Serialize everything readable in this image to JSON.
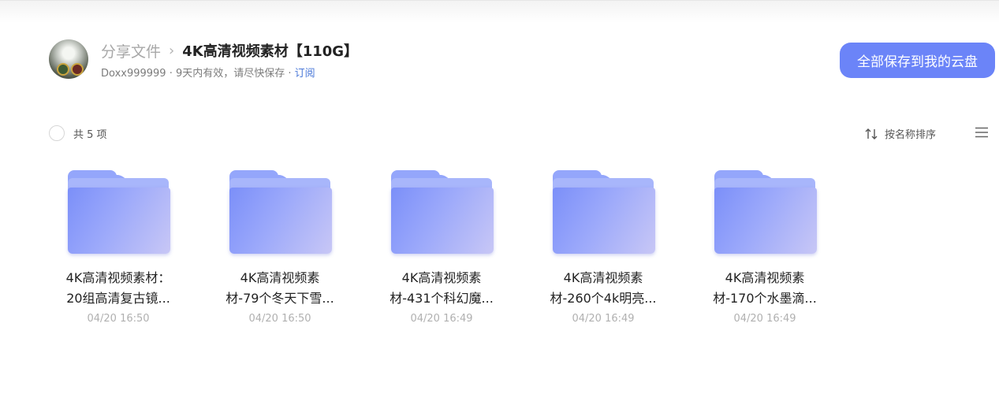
{
  "header": {
    "breadcrumb_root": "分享文件",
    "breadcrumb_sep": "›",
    "title": "4K高清视频素材【110G】",
    "user": "Doxx999999",
    "dot1": " · ",
    "validity": "9天内有效，请尽快保存",
    "dot2": " · ",
    "subscribe": "订阅",
    "save_all": "全部保存到我的云盘"
  },
  "toolbar": {
    "count": "共 5 项",
    "sort": "按名称排序"
  },
  "files": [
    {
      "name_line1": "4K高清视频素材：",
      "name_line2": "20组高清复古镜...",
      "date": "04/20 16:50"
    },
    {
      "name_line1": "4K高清视频素",
      "name_line2": "材-79个冬天下雪...",
      "date": "04/20 16:50"
    },
    {
      "name_line1": "4K高清视频素",
      "name_line2": "材-431个科幻魔...",
      "date": "04/20 16:49"
    },
    {
      "name_line1": "4K高清视频素",
      "name_line2": "材-260个4k明亮...",
      "date": "04/20 16:49"
    },
    {
      "name_line1": "4K高清视频素",
      "name_line2": "材-170个水墨滴...",
      "date": "04/20 16:49"
    }
  ],
  "colors": {
    "accent": "#6b84f8",
    "link": "#4a78d8"
  }
}
